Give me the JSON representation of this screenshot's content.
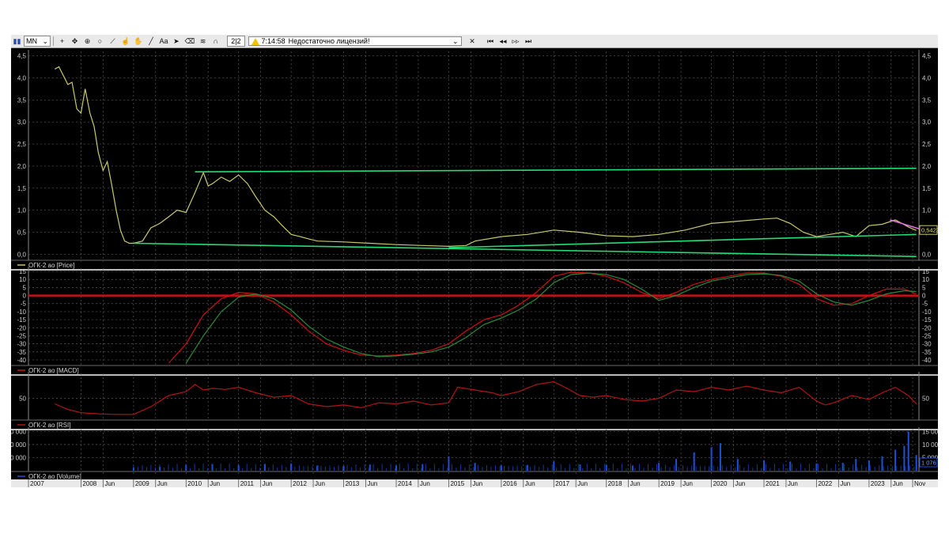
{
  "toolbar": {
    "period": "MN",
    "counter": "2|2",
    "status_time": "7:14:58",
    "status_message": "Недостаточно лицензий!",
    "tools": [
      {
        "name": "bar-chart-icon",
        "glyph": "▮"
      },
      {
        "name": "crosshair-icon",
        "glyph": "+"
      },
      {
        "name": "move-icon",
        "glyph": "✥"
      },
      {
        "name": "target-icon",
        "glyph": "⊕"
      },
      {
        "name": "circle-icon",
        "glyph": "○"
      },
      {
        "name": "ruler-icon",
        "glyph": "⟋"
      },
      {
        "name": "hand-pointer-icon",
        "glyph": "☝"
      },
      {
        "name": "hand-icon",
        "glyph": "✋"
      },
      {
        "name": "line-tool-icon",
        "glyph": "╱"
      },
      {
        "name": "text-tool-icon",
        "glyph": "Aa"
      },
      {
        "name": "arrow-tool-icon",
        "glyph": "➤"
      },
      {
        "name": "eraser-icon",
        "glyph": "⌫"
      },
      {
        "name": "layers-icon",
        "glyph": "≋"
      },
      {
        "name": "magnet-icon",
        "glyph": "∩"
      }
    ],
    "nav": [
      "✕",
      "⏮",
      "◂◂",
      "▹▹",
      "⏭"
    ]
  },
  "chart_data": [
    {
      "type": "line",
      "legend": "ОГК-2 ао [Price]",
      "yticks": [
        "4,5",
        "4,0",
        "3,5",
        "3,0",
        "2,5",
        "2,0",
        "1,5",
        "1,0",
        "0,5",
        "0,0"
      ],
      "ylim": [
        -0.1,
        4.6
      ],
      "last_value_label": "0,5422",
      "series": [
        {
          "color": "#c8c86e",
          "x": [
            2007.5,
            2007.58,
            2007.75,
            2007.83,
            2007.92,
            2008.0,
            2008.08,
            2008.17,
            2008.25,
            2008.33,
            2008.42,
            2008.5,
            2008.58,
            2008.67,
            2008.75,
            2008.83,
            2008.92,
            2009.0,
            2009.17,
            2009.33,
            2009.5,
            2009.67,
            2009.83,
            2010.0,
            2010.17,
            2010.33,
            2010.42,
            2010.5,
            2010.67,
            2010.83,
            2011.0,
            2011.17,
            2011.33,
            2011.5,
            2011.67,
            2011.83,
            2012.0,
            2012.17,
            2012.33,
            2012.5,
            2013.0,
            2013.5,
            2014.0,
            2014.5,
            2015.0,
            2015.33,
            2015.5,
            2016.0,
            2016.5,
            2017.0,
            2017.5,
            2018.0,
            2018.5,
            2019.0,
            2019.5,
            2020.0,
            2020.5,
            2021.0,
            2021.25,
            2021.5,
            2021.75,
            2022.0,
            2022.25,
            2022.5,
            2022.75,
            2023.0,
            2023.25,
            2023.5,
            2023.75,
            2023.9
          ],
          "y": [
            4.2,
            4.25,
            3.85,
            3.9,
            3.3,
            3.2,
            3.75,
            3.2,
            2.9,
            2.3,
            1.9,
            2.1,
            1.6,
            1.0,
            0.55,
            0.3,
            0.25,
            0.25,
            0.3,
            0.6,
            0.7,
            0.85,
            1.0,
            0.95,
            1.4,
            1.85,
            1.55,
            1.6,
            1.75,
            1.65,
            1.8,
            1.6,
            1.3,
            1.0,
            0.85,
            0.65,
            0.45,
            0.4,
            0.35,
            0.3,
            0.28,
            0.25,
            0.22,
            0.2,
            0.18,
            0.2,
            0.3,
            0.4,
            0.45,
            0.55,
            0.5,
            0.42,
            0.4,
            0.45,
            0.55,
            0.7,
            0.75,
            0.8,
            0.82,
            0.7,
            0.5,
            0.4,
            0.45,
            0.5,
            0.4,
            0.65,
            0.68,
            0.78,
            0.62,
            0.54
          ]
        }
      ],
      "trendlines": [
        {
          "color": "#22dd77",
          "x": [
            2010.17,
            2023.9
          ],
          "y": [
            1.87,
            1.95
          ]
        },
        {
          "color": "#22dd77",
          "x": [
            2009.0,
            2023.9
          ],
          "y": [
            0.25,
            -0.05
          ]
        },
        {
          "color": "#22dd77",
          "x": [
            2015.0,
            2023.9
          ],
          "y": [
            0.15,
            0.45
          ]
        },
        {
          "color": "#e070e0",
          "x": [
            2023.4,
            2023.95
          ],
          "y": [
            0.78,
            0.58
          ]
        }
      ]
    },
    {
      "type": "line",
      "legend": "ОГК-2 ао [MACD]",
      "yticks": [
        "15",
        "10",
        "5",
        "0",
        "-5",
        "-10",
        "-15",
        "-20",
        "-25",
        "-30",
        "-35",
        "-40"
      ],
      "ylim": [
        -42,
        17
      ],
      "zero_line_color": "#cc1111",
      "series": [
        {
          "color": "#cc1111",
          "x": [
            2009.67,
            2010.0,
            2010.33,
            2010.67,
            2011.0,
            2011.33,
            2011.67,
            2012.0,
            2012.33,
            2012.67,
            2013.0,
            2013.33,
            2013.67,
            2014.0,
            2014.33,
            2014.67,
            2015.0,
            2015.33,
            2015.67,
            2016.0,
            2016.33,
            2016.67,
            2017.0,
            2017.33,
            2017.67,
            2018.0,
            2018.33,
            2018.67,
            2019.0,
            2019.33,
            2019.67,
            2020.0,
            2020.33,
            2020.67,
            2021.0,
            2021.33,
            2021.67,
            2022.0,
            2022.33,
            2022.67,
            2023.0,
            2023.33,
            2023.67,
            2023.9
          ],
          "y": [
            -42,
            -30,
            -12,
            -2,
            2,
            1,
            -4,
            -12,
            -22,
            -30,
            -34,
            -37,
            -37.5,
            -37,
            -36,
            -34,
            -30,
            -22,
            -15,
            -12,
            -6,
            2,
            12,
            14.5,
            14,
            12,
            8,
            2,
            -2,
            2,
            7,
            10,
            12,
            14,
            14,
            12,
            7,
            -2,
            -6,
            -5,
            0,
            4,
            4,
            1
          ]
        },
        {
          "color": "#2a8a3a",
          "x": [
            2010.0,
            2010.33,
            2010.67,
            2011.0,
            2011.33,
            2011.67,
            2012.0,
            2012.33,
            2012.67,
            2013.0,
            2013.33,
            2013.67,
            2014.0,
            2014.33,
            2014.67,
            2015.0,
            2015.33,
            2015.67,
            2016.0,
            2016.33,
            2016.67,
            2017.0,
            2017.33,
            2017.67,
            2018.0,
            2018.33,
            2018.67,
            2019.0,
            2019.33,
            2019.67,
            2020.0,
            2020.33,
            2020.67,
            2021.0,
            2021.33,
            2021.67,
            2022.0,
            2022.33,
            2022.67,
            2023.0,
            2023.33,
            2023.67,
            2023.9
          ],
          "y": [
            -42,
            -25,
            -10,
            -1,
            1,
            -2,
            -9,
            -19,
            -27,
            -32,
            -36,
            -38,
            -37.5,
            -36.5,
            -35,
            -32,
            -26,
            -18,
            -14,
            -9,
            -2,
            8,
            13,
            14,
            13,
            10,
            4,
            -3,
            0,
            5,
            9,
            11,
            13,
            13.5,
            12.5,
            9,
            1,
            -4,
            -6,
            -3,
            1,
            3,
            2.5
          ]
        }
      ]
    },
    {
      "type": "line",
      "legend": "ОГК-2 ао [RSI]",
      "yticks": [
        "50"
      ],
      "ylim": [
        15,
        95
      ],
      "series": [
        {
          "color": "#b01515",
          "x": [
            2007.5,
            2007.75,
            2008.0,
            2008.33,
            2008.67,
            2009.0,
            2009.33,
            2009.67,
            2010.0,
            2010.17,
            2010.33,
            2010.5,
            2010.75,
            2011.0,
            2011.33,
            2011.67,
            2012.0,
            2012.33,
            2012.67,
            2013.0,
            2013.33,
            2013.67,
            2014.0,
            2014.33,
            2014.67,
            2015.0,
            2015.17,
            2015.5,
            2015.83,
            2016.0,
            2016.33,
            2016.67,
            2017.0,
            2017.25,
            2017.5,
            2017.75,
            2018.0,
            2018.33,
            2018.67,
            2019.0,
            2019.33,
            2019.67,
            2020.0,
            2020.33,
            2020.67,
            2021.0,
            2021.33,
            2021.67,
            2022.0,
            2022.17,
            2022.33,
            2022.67,
            2023.0,
            2023.25,
            2023.5,
            2023.75,
            2023.9
          ],
          "y": [
            40,
            30,
            24,
            22,
            21,
            21,
            35,
            55,
            62,
            75,
            65,
            68,
            66,
            70,
            60,
            52,
            55,
            40,
            35,
            38,
            33,
            42,
            40,
            45,
            38,
            42,
            70,
            65,
            60,
            55,
            62,
            75,
            80,
            68,
            55,
            52,
            55,
            48,
            45,
            50,
            65,
            62,
            70,
            65,
            72,
            65,
            60,
            70,
            45,
            38,
            42,
            55,
            48,
            60,
            70,
            55,
            40
          ]
        }
      ]
    },
    {
      "type": "bar",
      "legend": "ОГК-2 ао [Volume]",
      "yticks_left": [
        "000 000",
        "000 000",
        "000 000"
      ],
      "yticks_right": [
        "15 000",
        "10 000",
        "5 000"
      ],
      "last_value_label": "1 076",
      "ylim": [
        0,
        16000
      ],
      "color": "#1f4fd6",
      "x": [
        2009.0,
        2009.5,
        2010.0,
        2010.5,
        2011.0,
        2011.5,
        2012.0,
        2012.5,
        2013.0,
        2013.5,
        2014.0,
        2014.5,
        2015.0,
        2015.5,
        2016.0,
        2016.5,
        2017.0,
        2017.5,
        2018.0,
        2018.5,
        2019.0,
        2019.33,
        2019.67,
        2020.0,
        2020.17,
        2020.5,
        2021.0,
        2021.5,
        2022.0,
        2022.5,
        2022.75,
        2023.0,
        2023.25,
        2023.5,
        2023.67,
        2023.75,
        2023.9
      ],
      "y": [
        1200,
        1500,
        2200,
        2500,
        2000,
        2600,
        2800,
        2000,
        1800,
        2400,
        2000,
        2500,
        5500,
        3000,
        2000,
        2200,
        3500,
        2400,
        2200,
        2000,
        3000,
        4500,
        7000,
        9000,
        10500,
        4500,
        4000,
        3500,
        2800,
        3000,
        4500,
        4000,
        5500,
        8000,
        9500,
        15000,
        6000
      ]
    }
  ],
  "xaxis": {
    "labels": [
      "2007",
      "2008",
      "Jun",
      "2009",
      "Jun",
      "2010",
      "Jun",
      "2011",
      "Jun",
      "2012",
      "Jun",
      "2013",
      "Jun",
      "2014",
      "Jun",
      "2015",
      "Jun",
      "2016",
      "Jun",
      "2017",
      "Jun",
      "2018",
      "Jun",
      "2019",
      "Jun",
      "2020",
      "Jun",
      "2021",
      "Jun",
      "2022",
      "Jun",
      "2023",
      "Jun",
      "Nov"
    ],
    "positions": [
      2007.0,
      2008.0,
      2008.42,
      2009.0,
      2009.42,
      2010.0,
      2010.42,
      2011.0,
      2011.42,
      2012.0,
      2012.42,
      2013.0,
      2013.42,
      2014.0,
      2014.42,
      2015.0,
      2015.42,
      2016.0,
      2016.42,
      2017.0,
      2017.42,
      2018.0,
      2018.42,
      2019.0,
      2019.42,
      2020.0,
      2020.42,
      2021.0,
      2021.42,
      2022.0,
      2022.42,
      2023.0,
      2023.42,
      2023.83
    ],
    "range": [
      2007.0,
      2023.95
    ]
  }
}
